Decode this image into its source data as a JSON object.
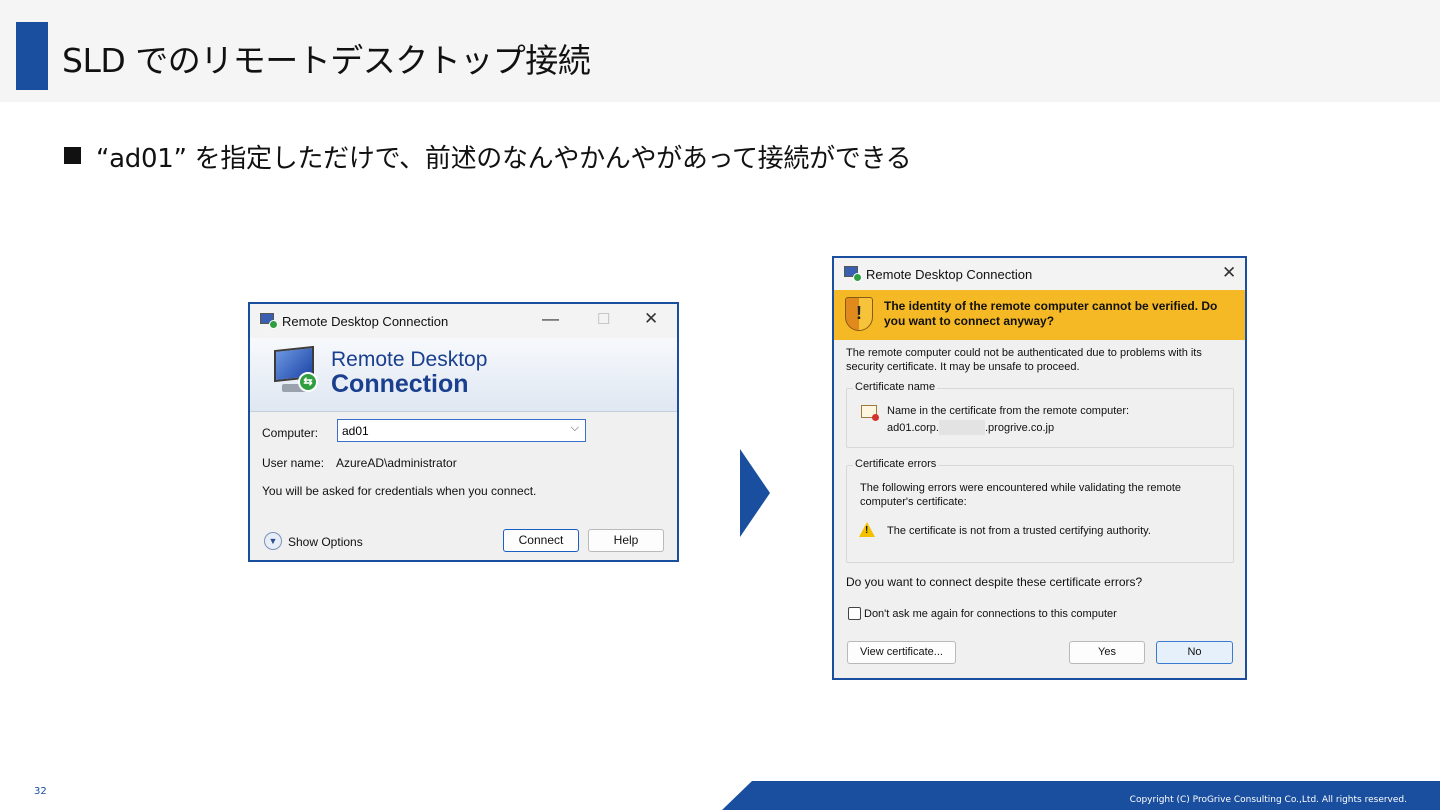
{
  "slide": {
    "title": "SLD でのリモートデスクトップ接続",
    "bullet": "“ad01” を指定しただけで、前述のなんやかんやがあって接続ができる",
    "page_number": "32",
    "copyright": "Copyright (C) ProGrive Consulting Co.,Ltd. All rights reserved.",
    "accent_color": "#1a4fa0"
  },
  "dialog1": {
    "title": "Remote Desktop Connection",
    "banner_line1": "Remote Desktop",
    "banner_line2": "Connection",
    "computer_label": "Computer:",
    "computer_value": "ad01",
    "username_label": "User name:",
    "username_value": "AzureAD\\administrator",
    "info": "You will be asked for credentials when you connect.",
    "show_options": "Show Options",
    "connect_button": "Connect",
    "help_button": "Help",
    "icons": [
      "rdc-icon",
      "minimize-icon",
      "maximize-icon",
      "close-icon",
      "chevron-down-icon",
      "expand-options-icon"
    ]
  },
  "dialog2": {
    "title": "Remote Desktop Connection",
    "warning_heading": "The identity of the remote computer cannot be verified. Do you want to connect anyway?",
    "description": "The remote computer could not be authenticated due to problems with its security certificate. It may be unsafe to proceed.",
    "cert_name_group": "Certificate name",
    "cert_name_label": "Name in the certificate from the remote computer:",
    "cert_name_prefix": "ad01.corp.",
    "cert_name_suffix": ".progrive.co.jp",
    "cert_errors_group": "Certificate errors",
    "cert_errors_desc": "The following errors were encountered while validating the remote computer's certificate:",
    "cert_error_item": "The certificate is not from a trusted certifying authority.",
    "question": "Do you want to connect despite these certificate errors?",
    "dont_ask": "Don't ask me again for connections to this computer",
    "dont_ask_checked": false,
    "view_cert_button": "View certificate...",
    "yes_button": "Yes",
    "no_button": "No",
    "warning_color": "#f5b925",
    "icons": [
      "rdc-icon",
      "close-icon",
      "shield-warning-icon",
      "certificate-icon",
      "warning-triangle-icon"
    ]
  }
}
